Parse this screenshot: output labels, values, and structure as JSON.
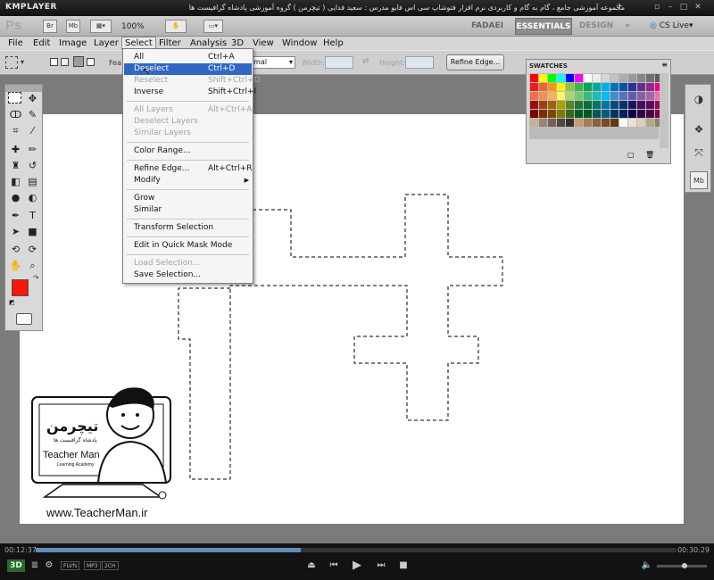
{
  "kmplayer": {
    "logo": "KMPLAYER",
    "caption": "مجموعه آموزشی جامع ، گام به گام و کاربردی نرم افزار فتوشاپ سی اس فایو   مدرس : سعید فدایی ( تیچرمن ) گروه آموزشی پادشاه گرافیست ها",
    "time_elapsed": "00:12:37",
    "time_total": "00:30:29",
    "progress": 0.414,
    "volume": 0.55,
    "badges": [
      "FLVfs",
      "MP3",
      "2CH"
    ]
  },
  "appbar": {
    "logo": "Ps",
    "zoom": "100%",
    "workspaces": [
      "FADAEI",
      "ESSENTIALS",
      "DESIGN",
      "»"
    ],
    "active_workspace": "ESSENTIALS",
    "cs_live": "CS Live"
  },
  "menubar": [
    "File",
    "Edit",
    "Image",
    "Layer",
    "Select",
    "Filter",
    "Analysis",
    "3D",
    "View",
    "Window",
    "Help"
  ],
  "options": {
    "feather_label": "Fea",
    "mode_value": "rmal",
    "width_label": "Width:",
    "height_label": "Height:",
    "refine_edge": "Refine Edge..."
  },
  "select_menu": [
    {
      "label": "All",
      "shortcut": "Ctrl+A",
      "state": "enabled"
    },
    {
      "label": "Deselect",
      "shortcut": "Ctrl+D",
      "state": "hover"
    },
    {
      "label": "Reselect",
      "shortcut": "Shift+Ctrl+D",
      "state": "disabled"
    },
    {
      "label": "Inverse",
      "shortcut": "Shift+Ctrl+I",
      "state": "enabled"
    },
    {
      "label": "All Layers",
      "shortcut": "Alt+Ctrl+A",
      "state": "disabled"
    },
    {
      "label": "Deselect Layers",
      "shortcut": "",
      "state": "disabled"
    },
    {
      "label": "Similar Layers",
      "shortcut": "",
      "state": "disabled"
    },
    {
      "label": "Color Range...",
      "shortcut": "",
      "state": "enabled"
    },
    {
      "label": "Refine Edge...",
      "shortcut": "Alt+Ctrl+R",
      "state": "enabled"
    },
    {
      "label": "Modify",
      "shortcut": "",
      "state": "submenu"
    },
    {
      "label": "Grow",
      "shortcut": "",
      "state": "enabled"
    },
    {
      "label": "Similar",
      "shortcut": "",
      "state": "enabled"
    },
    {
      "label": "Transform Selection",
      "shortcut": "",
      "state": "enabled"
    },
    {
      "label": "Edit in Quick Mask Mode",
      "shortcut": "",
      "state": "enabled"
    },
    {
      "label": "Load Selection...",
      "shortcut": "",
      "state": "disabled"
    },
    {
      "label": "Save Selection...",
      "shortcut": "",
      "state": "enabled"
    }
  ],
  "swatches": {
    "title": "SWATCHES",
    "colors": [
      "#ff0000",
      "#ffff00",
      "#00ff00",
      "#00ffff",
      "#0000ff",
      "#ff00ff",
      "#ffffff",
      "#ebebeb",
      "#d6d6d6",
      "#c2c2c2",
      "#adadad",
      "#999999",
      "#858585",
      "#707070",
      "#5c5c5c",
      "#ed1c24",
      "#f26522",
      "#f7941d",
      "#fff200",
      "#8dc63f",
      "#39b54a",
      "#00a651",
      "#00a99d",
      "#00aeef",
      "#0072bc",
      "#0054a6",
      "#2e3192",
      "#662d91",
      "#92278f",
      "#ec008c",
      "#f26c4f",
      "#f68e56",
      "#fbaf5d",
      "#fff568",
      "#acd373",
      "#7cc576",
      "#3bb878",
      "#1abbb4",
      "#00bff3",
      "#438cca",
      "#5574b9",
      "#605ca8",
      "#855fa8",
      "#a763a8",
      "#f06eaa",
      "#9e0b0f",
      "#a0410d",
      "#a36209",
      "#aba000",
      "#598527",
      "#1a7b30",
      "#007236",
      "#00746b",
      "#0076a3",
      "#004b80",
      "#003471",
      "#1b1464",
      "#440e62",
      "#630460",
      "#9e005d",
      "#790000",
      "#7b2e00",
      "#7d4900",
      "#827b00",
      "#406618",
      "#005e20",
      "#005826",
      "#005952",
      "#005b7f",
      "#003663",
      "#002157",
      "#0d004c",
      "#32004b",
      "#4b0049",
      "#7b0046",
      "#c7b299",
      "#998675",
      "#736357",
      "#534741",
      "#37302d",
      "#c69c6d",
      "#a67c52",
      "#8c6239",
      "#754c24",
      "#603913",
      "#fbf9f4",
      "#e8e2d3",
      "#d7cfb8",
      "#b6a78a",
      "#8f8266"
    ]
  },
  "teacherman": {
    "url": "www.TeacherMan.ir",
    "brand_fa": "تیچرمن",
    "subtitle_fa": "پادشاه گرافیست ها",
    "brand_en": "Teacher Man",
    "tagline": "Learning Academy"
  }
}
